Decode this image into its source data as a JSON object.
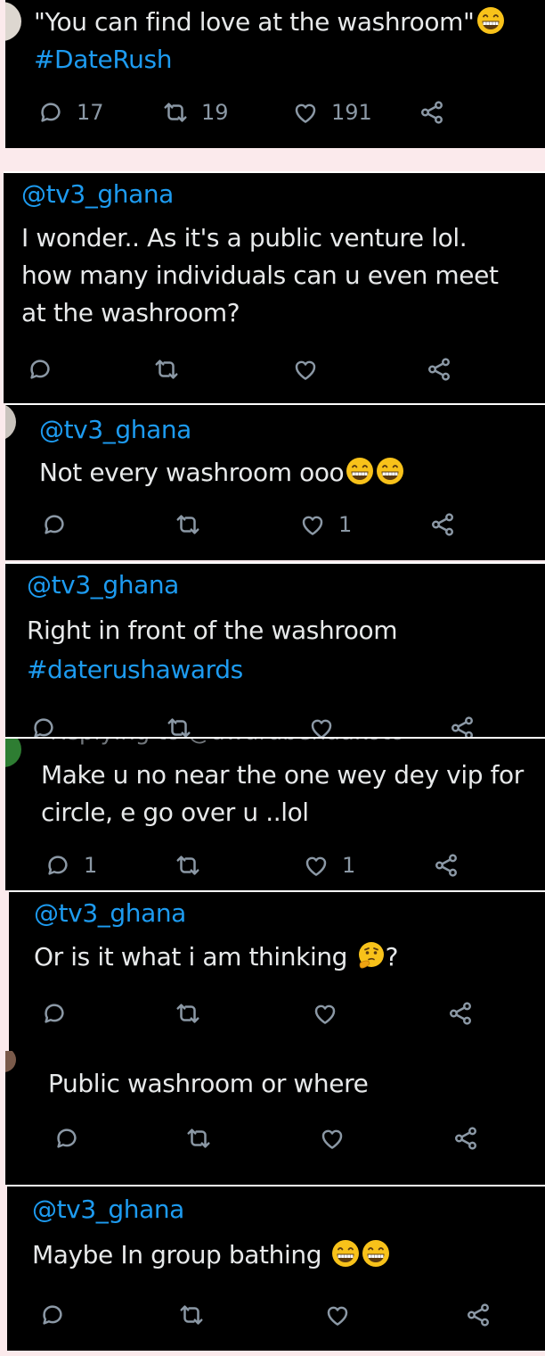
{
  "tweets": [
    {
      "text": "\"You can find love at the washroom\"",
      "hashtag": "#DateRush",
      "reply_count": "17",
      "retweet_count": "19",
      "like_count": "191"
    },
    {
      "mention": "@tv3_ghana",
      "lines": [
        "I wonder.. As it's a public venture lol.",
        "how many individuals can u even meet",
        "at the washroom?"
      ]
    },
    {
      "mention": "@tv3_ghana",
      "text": "Not every washroom ooo",
      "like_count": "1"
    },
    {
      "mention": "@tv3_ghana",
      "text": "Right in front of the washroom",
      "hashtag": "#daterushawards"
    },
    {
      "cutoff_text": "Replying to @awurabenaakoto",
      "lines": [
        "Make u no near the one wey dey vip for",
        "circle, e go over u ..lol"
      ],
      "reply_count": "1",
      "like_count": "1"
    },
    {
      "mention": "@tv3_ghana",
      "text": "Or is it what i am thinking",
      "suffix": "?"
    },
    {
      "text": "Public washroom or where"
    },
    {
      "mention": "@tv3_ghana",
      "text": "Maybe In group bathing"
    }
  ],
  "icons": {
    "reply": "reply-icon",
    "retweet": "retweet-icon",
    "like": "heart-icon",
    "share": "share-icon",
    "grin_emoji": "grinning-squinting-face-emoji",
    "think_emoji": "thinking-face-emoji"
  },
  "colors": {
    "background": "#000000",
    "text": "#e7e9ea",
    "link": "#1d9bf0",
    "icon": "#8b98a5",
    "page": "#fbeaec"
  }
}
